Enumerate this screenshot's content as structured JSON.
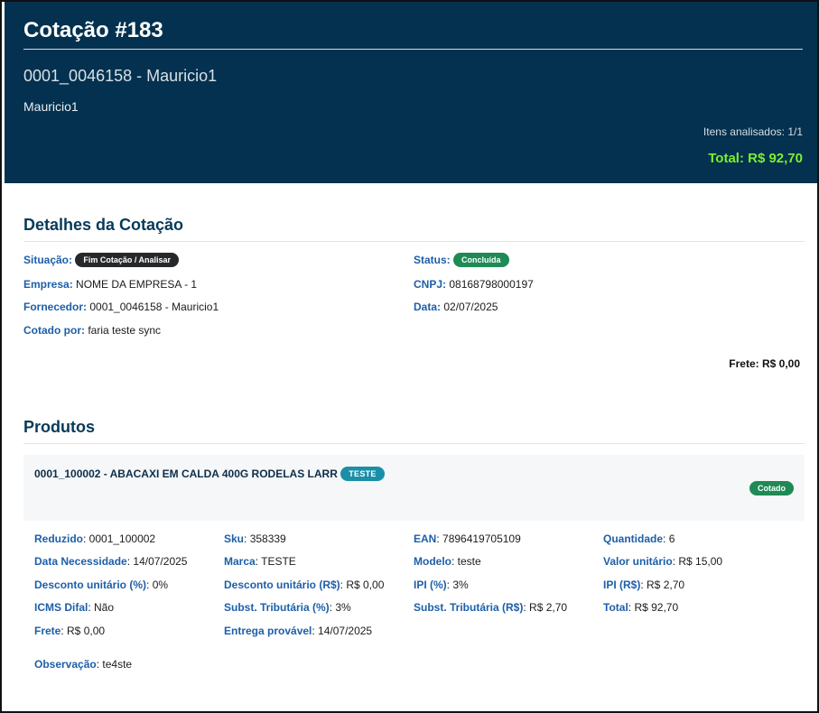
{
  "header": {
    "title": "Cotação #183",
    "supplier_line": "0001_0046158 - Mauricio1",
    "supplier_name": "Mauricio1",
    "items_analyzed": "Itens analisados: 1/1",
    "total": "Total: R$ 92,70"
  },
  "details": {
    "section_title": "Detalhes da Cotação",
    "situacao_label": "Situação:",
    "situacao_value": "Fim Cotação / Analisar",
    "status_label": "Status:",
    "status_value": "Concluída",
    "empresa_label": "Empresa:",
    "empresa_value": "NOME DA EMPRESA - 1",
    "cnpj_label": "CNPJ:",
    "cnpj_value": "08168798000197",
    "fornecedor_label": "Fornecedor:",
    "fornecedor_value": "0001_0046158 - Mauricio1",
    "data_label": "Data:",
    "data_value": "02/07/2025",
    "cotado_label": "Cotado por:",
    "cotado_value": "faria teste sync",
    "frete": "Frete: R$ 0,00"
  },
  "products": {
    "section_title": "Produtos",
    "items": [
      {
        "name": "0001_100002 - ABACAXI EM CALDA 400G RODELAS LARR",
        "tag": "TESTE",
        "status": "Cotado",
        "fields": {
          "reduzido": {
            "label": "Reduzido",
            "value": "0001_100002"
          },
          "sku": {
            "label": "Sku",
            "value": "358339"
          },
          "ean": {
            "label": "EAN",
            "value": "7896419705109"
          },
          "quantidade": {
            "label": "Quantidade",
            "value": "6"
          },
          "data_necessidade": {
            "label": "Data Necessidade",
            "value": "14/07/2025"
          },
          "marca": {
            "label": "Marca",
            "value": "TESTE"
          },
          "modelo": {
            "label": "Modelo",
            "value": "teste"
          },
          "valor_unitario": {
            "label": "Valor unitário",
            "value": "R$ 15,00"
          },
          "desconto_pct": {
            "label": "Desconto unitário (%)",
            "value": "0%"
          },
          "desconto_rs": {
            "label": "Desconto unitário (R$)",
            "value": "R$ 0,00"
          },
          "ipi_pct": {
            "label": "IPI (%)",
            "value": "3%"
          },
          "ipi_rs": {
            "label": "IPI (R$)",
            "value": "R$ 2,70"
          },
          "icms_difal": {
            "label": "ICMS Difal",
            "value": "Não"
          },
          "subst_pct": {
            "label": "Subst. Tributária (%)",
            "value": "3%"
          },
          "subst_rs": {
            "label": "Subst. Tributária (R$)",
            "value": "R$ 2,70"
          },
          "total": {
            "label": "Total",
            "value": "R$ 92,70"
          },
          "frete": {
            "label": "Frete",
            "value": "R$ 0,00"
          },
          "entrega": {
            "label": "Entrega provável",
            "value": "14/07/2025"
          },
          "observacao": {
            "label": "Observação",
            "value": "te4ste"
          }
        }
      }
    ]
  },
  "colors": {
    "header_bg": "#03314f",
    "total_green": "#7dee2f",
    "label_blue": "#1d5fa8",
    "badge_green": "#1e8a55",
    "badge_dark": "#26292c",
    "badge_teal": "#1a8fa8"
  }
}
